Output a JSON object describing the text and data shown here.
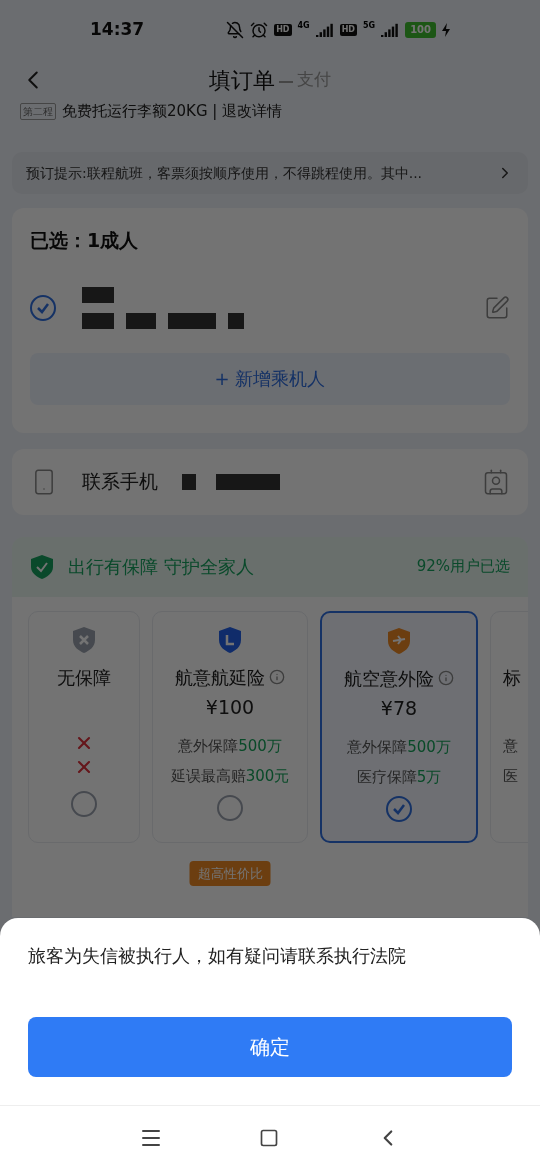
{
  "status_bar": {
    "time": "14:37",
    "sim1_badge": "HD",
    "sim1_network": "4G",
    "sim2_badge": "HD",
    "sim2_network": "5G",
    "battery": "100"
  },
  "nav": {
    "title": "填订单",
    "next_step": "支付"
  },
  "trip_info": {
    "segment_tag": "第二程",
    "text": "免费托运行李额20KG | 退改详情"
  },
  "notice": {
    "text": "预订提示:联程航班，客票须按顺序使用，不得跳程使用。其中..."
  },
  "passengers": {
    "heading": "已选：1成人",
    "items": [
      {
        "selected": true
      }
    ],
    "add_button": "+ 新增乘机人"
  },
  "contact": {
    "label": "联系手机"
  },
  "insurance": {
    "title": "出行有保障 守护全家人",
    "popularity": "92%用户已选",
    "plans": [
      {
        "kind": "none",
        "name": "无保障",
        "features": [
          {
            "kind": "excluded"
          },
          {
            "kind": "excluded"
          }
        ],
        "selected": false
      },
      {
        "kind": "delay",
        "name": "航意航延险",
        "price": "¥100",
        "features": [
          {
            "kind": "included",
            "label": "意外保障",
            "value": "500万"
          },
          {
            "kind": "included",
            "label": "延误最高赔",
            "value": "300元"
          }
        ],
        "selected": false,
        "tag": "超高性价比"
      },
      {
        "kind": "accident",
        "name": "航空意外险",
        "price": "¥78",
        "features": [
          {
            "kind": "included",
            "label": "意外保障",
            "value": "500万"
          },
          {
            "kind": "included",
            "label": "医疗保障",
            "value": "5万"
          }
        ],
        "selected": true
      },
      {
        "kind": "partial",
        "name": "标",
        "features": [
          {
            "kind": "included",
            "label": "意"
          },
          {
            "kind": "included",
            "label": "医"
          }
        ]
      }
    ]
  },
  "dialog": {
    "message": "旅客为失信被执行人，如有疑问请联系执行法院",
    "button": "确定"
  }
}
